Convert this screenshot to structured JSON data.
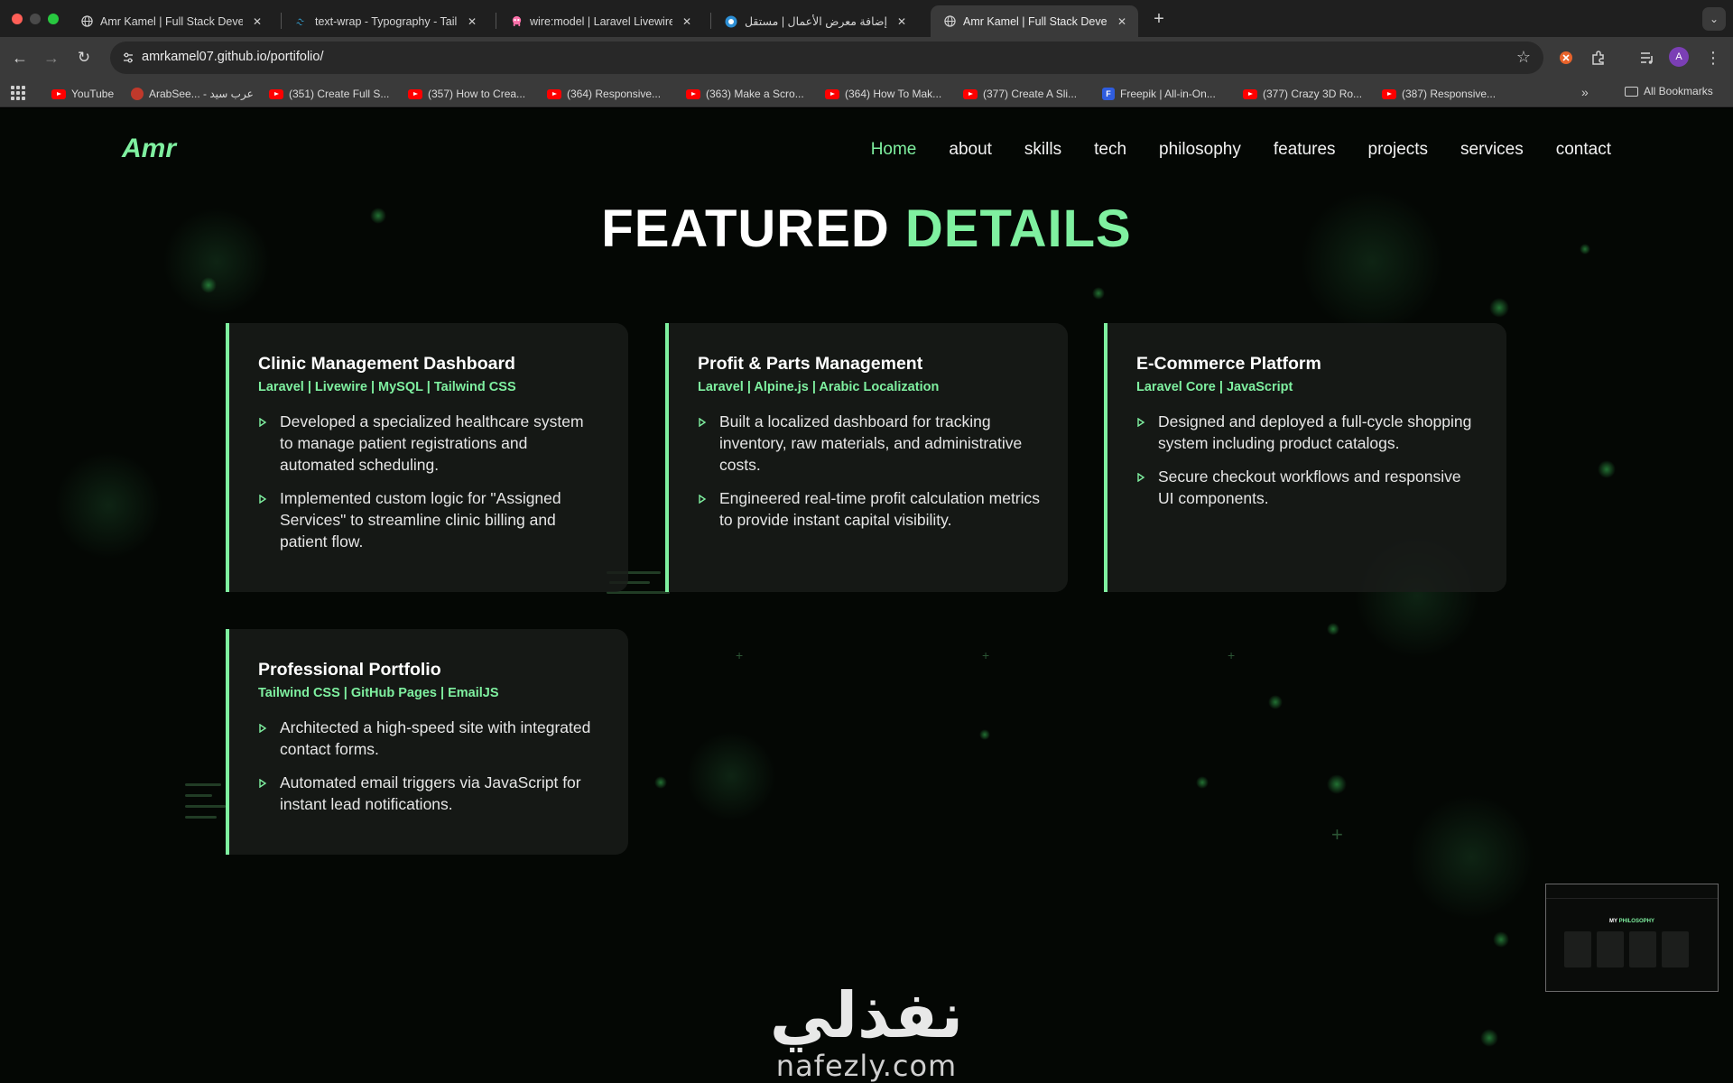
{
  "browser": {
    "tabs": [
      {
        "title": "Amr Kamel | Full Stack Develo",
        "favicon": "globe-icon",
        "active": false
      },
      {
        "title": "text-wrap - Typography - Tail",
        "favicon": "tailwind-icon",
        "active": false
      },
      {
        "title": "wire:model | Laravel Livewire",
        "favicon": "livewire-icon",
        "active": false
      },
      {
        "title": "إضافة معرض الأعمال | مستقل",
        "favicon": "mostaql-icon",
        "active": false
      },
      {
        "title": "Amr Kamel | Full Stack Develo",
        "favicon": "globe-icon",
        "active": true
      }
    ],
    "url": "amrkamel07.github.io/portifolio/",
    "avatar_letter": "A",
    "bookmarks": [
      {
        "label": "YouTube",
        "icon": "youtube-icon"
      },
      {
        "label": "ArabSee... - عرب سيد",
        "icon": "arabseed-icon"
      },
      {
        "label": "(351) Create Full S...",
        "icon": "youtube-icon"
      },
      {
        "label": "(357) How to Crea...",
        "icon": "youtube-icon"
      },
      {
        "label": "(364) Responsive...",
        "icon": "youtube-icon"
      },
      {
        "label": "(363) Make a Scro...",
        "icon": "youtube-icon"
      },
      {
        "label": "(364) How To Mak...",
        "icon": "youtube-icon"
      },
      {
        "label": "(377) Create A Sli...",
        "icon": "youtube-icon"
      },
      {
        "label": "Freepik | All-in-On...",
        "icon": "freepik-icon"
      },
      {
        "label": "(377) Crazy 3D Ro...",
        "icon": "youtube-icon"
      },
      {
        "label": "(387) Responsive...",
        "icon": "youtube-icon"
      }
    ],
    "all_bookmarks_label": "All Bookmarks"
  },
  "site": {
    "logo": "Amr",
    "nav": [
      "Home",
      "about",
      "skills",
      "tech",
      "philosophy",
      "features",
      "projects",
      "services",
      "contact"
    ],
    "active_nav": "Home",
    "section_title_main": "FEATURED",
    "section_title_accent": "DETAILS",
    "cards": [
      {
        "title": "Clinic Management Dashboard",
        "tech": "Laravel | Livewire | MySQL | Tailwind CSS",
        "points": [
          "Developed a specialized healthcare system to manage patient registrations and automated scheduling.",
          "Implemented custom logic for \"Assigned Services\" to streamline clinic billing and patient flow."
        ]
      },
      {
        "title": "Profit & Parts Management",
        "tech": "Laravel | Alpine.js | Arabic Localization",
        "points": [
          "Built a localized dashboard for tracking inventory, raw materials, and administrative costs.",
          "Engineered real-time profit calculation metrics to provide instant capital visibility."
        ]
      },
      {
        "title": "E-Commerce Platform",
        "tech": "Laravel Core | JavaScript",
        "points": [
          "Designed and deployed a full-cycle shopping system including product catalogs.",
          "Secure checkout workflows and responsive UI components."
        ]
      },
      {
        "title": "Professional Portfolio",
        "tech": "Tailwind CSS | GitHub Pages | EmailJS",
        "points": [
          "Architected a high-speed site with integrated contact forms.",
          "Automated email triggers via JavaScript for instant lead notifications."
        ]
      }
    ],
    "pip_title_main": "MY",
    "pip_title_accent": "PHILOSOPHY"
  },
  "watermark": {
    "arabic": "نفذلي",
    "latin": "nafezly.com"
  },
  "colors": {
    "accent": "#7ff0a0",
    "page_bg": "#040704",
    "card_bg": "#1a1c1a"
  }
}
